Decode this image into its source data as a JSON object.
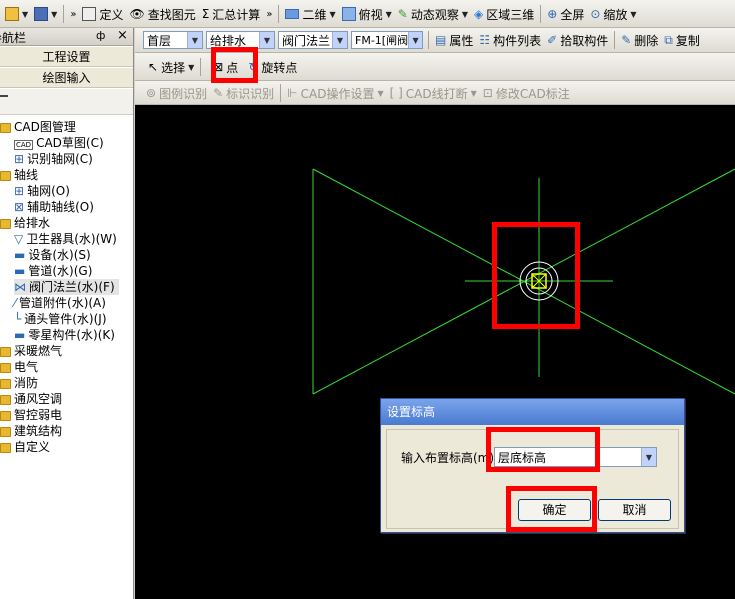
{
  "toolbar1": {
    "define": "定义",
    "find": "查找图元",
    "sum": "汇总计算",
    "view2d": "二维",
    "topview": "俯视",
    "orbit": "动态观察",
    "region3d": "区域三维",
    "fullscreen": "全屏",
    "zoom": "缩放"
  },
  "nav": {
    "title": "导航栏",
    "pin": "ф",
    "close": "×",
    "project_settings": "工程设置",
    "drawing_input": "绘图输入"
  },
  "tree": {
    "cad": "CAD图管理",
    "cad_sketch": "CAD草图(C)",
    "recognize_axis": "识别轴网(C)",
    "axis": "轴线",
    "axis_grid": "轴网(O)",
    "aux_axis": "辅助轴线(O)",
    "plumbing": "给排水",
    "sanitary": "卫生器具(水)(W)",
    "equipment": "设备(水)(S)",
    "pipe": "管道(水)(G)",
    "valve": "阀门法兰(水)(F)",
    "pipe_accessory": "管道附件(水)(A)",
    "fitting": "通头管件(水)(J)",
    "misc": "零星构件(水)(K)",
    "hvac_gas": "采暖燃气",
    "electric": "电气",
    "fire": "消防",
    "ventilation": "通风空调",
    "smart": "智控弱电",
    "structure": "建筑结构",
    "custom": "自定义"
  },
  "toolbar2": {
    "floor": "首层",
    "discipline": "给排水",
    "component_type": "阀门法兰",
    "component": "FM-1[闸阀",
    "properties": "属性",
    "component_list": "构件列表",
    "pick": "拾取构件",
    "delete": "删除",
    "copy": "复制"
  },
  "toolbar3": {
    "select": "选择",
    "point": "点",
    "rotate_point": "旋转点"
  },
  "toolbar4": {
    "legend": "图例识别",
    "mark": "标识识别",
    "cad_ops": "CAD操作设置",
    "cad_break": "CAD线打断",
    "modify_cad": "修改CAD标注"
  },
  "dialog": {
    "title": "设置标高",
    "label": "输入布置标高(m)",
    "value": "层底标高",
    "ok": "确定",
    "cancel": "取消"
  },
  "colors": {
    "canvas": "#000000",
    "cad_line": "#33dd33",
    "highlight": "#ff0000",
    "dialog_title": "#5a87d8"
  }
}
